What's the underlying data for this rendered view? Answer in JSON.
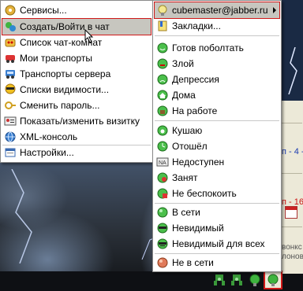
{
  "main_menu": {
    "items": [
      {
        "label": "Сервисы...",
        "icon": "services-icon"
      },
      {
        "label": "Создать/Войти в чат",
        "icon": "create-chat-icon"
      },
      {
        "label": "Список чат-комнат",
        "icon": "chatrooms-icon"
      },
      {
        "label": "Мои транспорты",
        "icon": "my-transports-icon"
      },
      {
        "label": "Транспорты сервера",
        "icon": "server-transports-icon"
      },
      {
        "label": "Списки видимости...",
        "icon": "visibility-lists-icon"
      },
      {
        "label": "Сменить пароль...",
        "icon": "change-password-icon"
      },
      {
        "label": "Показать/изменить визитку",
        "icon": "vcard-icon"
      },
      {
        "label": "XML-консоль",
        "icon": "xml-console-icon"
      },
      {
        "label": "Настройки...",
        "icon": "settings-icon"
      }
    ]
  },
  "account_menu": {
    "account": "cubemaster@jabber.ru",
    "bookmarks": "Закладки...",
    "statuses": [
      {
        "label": "Готов поболтать",
        "icon": "chatty-icon"
      },
      {
        "label": "Злой",
        "icon": "angry-icon"
      },
      {
        "label": "Депрессия",
        "icon": "depression-icon"
      },
      {
        "label": "Дома",
        "icon": "home-icon"
      },
      {
        "label": "На работе",
        "icon": "at-work-icon"
      },
      {
        "label": "Кушаю",
        "icon": "eating-icon"
      },
      {
        "label": "Отошёл",
        "icon": "away-icon"
      },
      {
        "label": "Недоступен",
        "icon": "not-available-icon"
      },
      {
        "label": "Занят",
        "icon": "busy-icon"
      },
      {
        "label": "Не беспокоить",
        "icon": "dnd-icon"
      },
      {
        "label": "В сети",
        "icon": "online-icon"
      },
      {
        "label": "Невидимый",
        "icon": "invisible-icon"
      },
      {
        "label": "Невидимый для всех",
        "icon": "invisible-all-icon"
      },
      {
        "label": "Не в сети",
        "icon": "offline-icon"
      }
    ]
  },
  "background_window": {
    "text_lines": [
      "п - 4 -",
      "п - 16",
      "вонкс",
      "лонов"
    ]
  },
  "colors": {
    "highlight": "#c7c6bf",
    "highlight_border": "#d01818",
    "status_green": "#2fa52f"
  }
}
